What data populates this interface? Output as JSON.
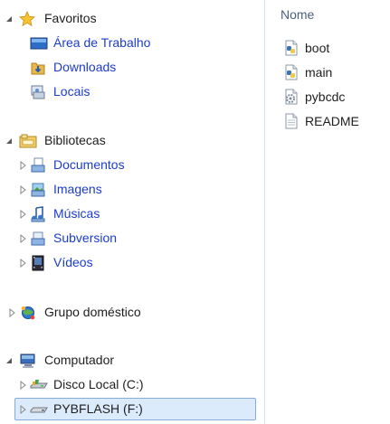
{
  "nav": {
    "favorites": {
      "label": "Favoritos",
      "items": [
        {
          "label": "Área de Trabalho",
          "icon": "desktop-icon"
        },
        {
          "label": "Downloads",
          "icon": "downloads-folder-icon"
        },
        {
          "label": "Locais",
          "icon": "recent-places-icon"
        }
      ]
    },
    "libraries": {
      "label": "Bibliotecas",
      "items": [
        {
          "label": "Documentos",
          "icon": "documents-library-icon"
        },
        {
          "label": "Imagens",
          "icon": "pictures-library-icon"
        },
        {
          "label": "Músicas",
          "icon": "music-library-icon"
        },
        {
          "label": "Subversion",
          "icon": "subversion-library-icon"
        },
        {
          "label": "Vídeos",
          "icon": "videos-library-icon"
        }
      ]
    },
    "homegroup": {
      "label": "Grupo doméstico"
    },
    "computer": {
      "label": "Computador",
      "items": [
        {
          "label": "Disco Local (C:)",
          "icon": "local-disk-icon"
        },
        {
          "label": "PYBFLASH (F:)",
          "icon": "removable-drive-icon",
          "selected": true
        }
      ]
    }
  },
  "files": {
    "column_header": "Nome",
    "items": [
      {
        "name": "boot",
        "icon": "python-file-icon"
      },
      {
        "name": "main",
        "icon": "python-file-icon"
      },
      {
        "name": "pybcdc",
        "icon": "settings-file-icon"
      },
      {
        "name": "README",
        "icon": "text-file-icon"
      }
    ]
  },
  "colors": {
    "link": "#1c3ccc",
    "selection_bg": "#dcebfc",
    "selection_border": "#84acdd",
    "header_text": "#4c607a"
  }
}
